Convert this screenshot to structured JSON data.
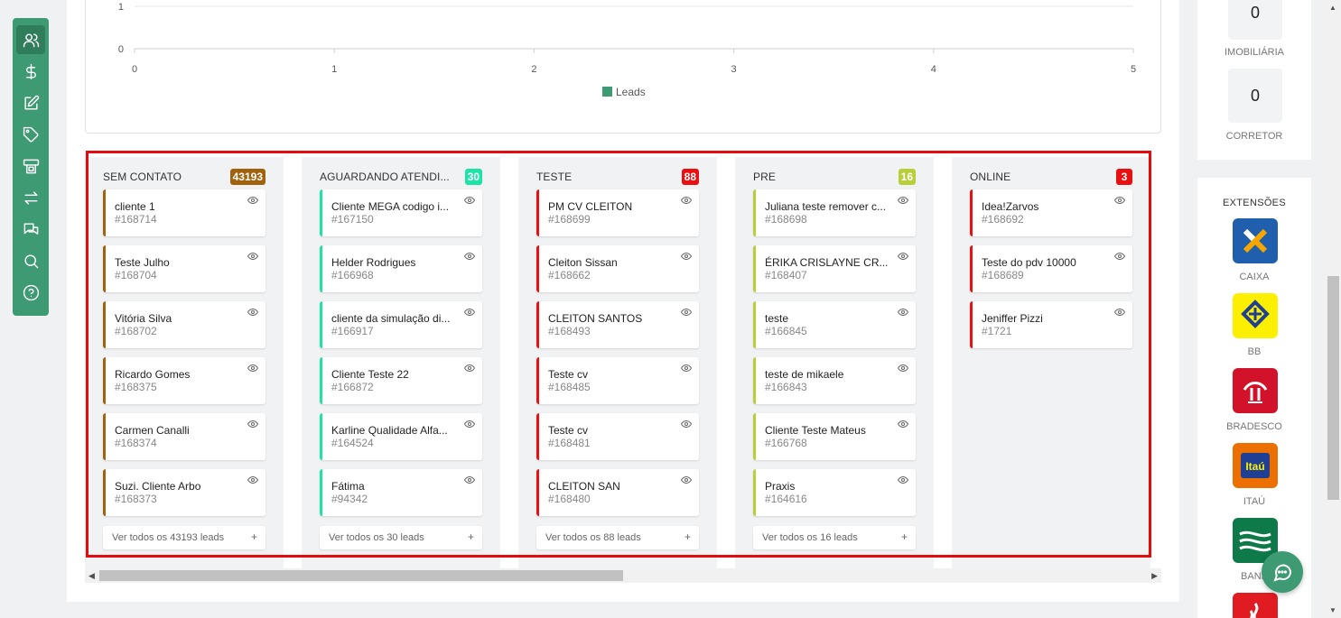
{
  "sidebar": {
    "items": [
      {
        "icon": "users-icon",
        "active": true
      },
      {
        "icon": "dollar-icon"
      },
      {
        "icon": "edit-icon"
      },
      {
        "icon": "tag-icon"
      },
      {
        "icon": "atm-icon"
      },
      {
        "icon": "transfer-icon"
      },
      {
        "icon": "chat-icon"
      },
      {
        "icon": "search-icon"
      },
      {
        "icon": "help-icon"
      }
    ],
    "color": "#3d9a72"
  },
  "chart_data": {
    "type": "bar",
    "orientation": "horizontal",
    "visible_y_ticks": [
      "1",
      "0"
    ],
    "x_ticks": [
      "0",
      "1",
      "2",
      "3",
      "4",
      "5"
    ],
    "xlim": [
      0,
      5
    ],
    "legend": [
      {
        "name": "Leads",
        "color": "#3d9a72"
      }
    ],
    "legend_position": "bottom-center",
    "grid": true,
    "values": []
  },
  "kanban": {
    "columns": [
      {
        "title": "SEM CONTATO",
        "count": "43193",
        "color": "#a0620c",
        "cards": [
          {
            "name": "cliente 1",
            "code": "#168714"
          },
          {
            "name": "Teste Julho",
            "code": "#168704"
          },
          {
            "name": "Vitória Silva",
            "code": "#168702"
          },
          {
            "name": "Ricardo Gomes",
            "code": "#168375"
          },
          {
            "name": "Carmen Canalli",
            "code": "#168374"
          },
          {
            "name": "Suzi. Cliente Arbo",
            "code": "#168373"
          }
        ],
        "view_all": "Ver todos os 43193 leads"
      },
      {
        "title": "AGUARDANDO ATENDI...",
        "count": "30",
        "color": "#1ee3a8",
        "cards": [
          {
            "name": "Cliente MEGA codigo i...",
            "code": "#167150"
          },
          {
            "name": "Helder Rodrigues",
            "code": "#166968"
          },
          {
            "name": "cliente da simulação di...",
            "code": "#166917"
          },
          {
            "name": "Cliente Teste 22",
            "code": "#166872"
          },
          {
            "name": "Karline Qualidade Alfa...",
            "code": "#164524"
          },
          {
            "name": "Fátima",
            "code": "#94342"
          }
        ],
        "view_all": "Ver todos os 30 leads"
      },
      {
        "title": "TESTE",
        "count": "88",
        "color": "#e81010",
        "cards": [
          {
            "name": "PM CV CLEITON",
            "code": "#168699"
          },
          {
            "name": "Cleiton Sissan",
            "code": "#168662"
          },
          {
            "name": "CLEITON SANTOS",
            "code": "#168493"
          },
          {
            "name": "Teste cv",
            "code": "#168485"
          },
          {
            "name": "Teste cv",
            "code": "#168481"
          },
          {
            "name": "CLEITON SAN",
            "code": "#168480"
          }
        ],
        "view_all": "Ver todos os 88 leads"
      },
      {
        "title": "PRE",
        "count": "16",
        "color": "#b8cf3a",
        "cards": [
          {
            "name": "Juliana teste remover c...",
            "code": "#168698"
          },
          {
            "name": "ÉRIKA CRISLAYNE CR...",
            "code": "#168407"
          },
          {
            "name": "teste",
            "code": "#166845"
          },
          {
            "name": "teste de mikaele",
            "code": "#166843"
          },
          {
            "name": "Cliente Teste Mateus",
            "code": "#166768"
          },
          {
            "name": "Praxis",
            "code": "#164616"
          }
        ],
        "view_all": "Ver todos os 16 leads"
      },
      {
        "title": "ONLINE",
        "count": "3",
        "color": "#e81010",
        "cards": [
          {
            "name": "Idea!Zarvos",
            "code": "#168692"
          },
          {
            "name": "Teste do pdv 10000",
            "code": "#168689"
          },
          {
            "name": "Jeniffer Pizzi",
            "code": "#1721"
          }
        ],
        "view_all": ""
      }
    ],
    "view_all_icon": "+"
  },
  "stats": [
    {
      "value": "0",
      "label": "IMOBILIÁRIA"
    },
    {
      "value": "0",
      "label": "CORRETOR"
    }
  ],
  "extensions": {
    "title": "EXTENSÕES",
    "items": [
      {
        "label": "CAIXA",
        "color": "#1f5fad"
      },
      {
        "label": "BB",
        "color": "#fcf000"
      },
      {
        "label": "BRADESCO",
        "color": "#d1122a"
      },
      {
        "label": "ITAÚ",
        "color": "#ec7000"
      },
      {
        "label": "BANE",
        "color": "#0e7a4a"
      },
      {
        "label": "",
        "color": "#e11b22"
      }
    ]
  }
}
